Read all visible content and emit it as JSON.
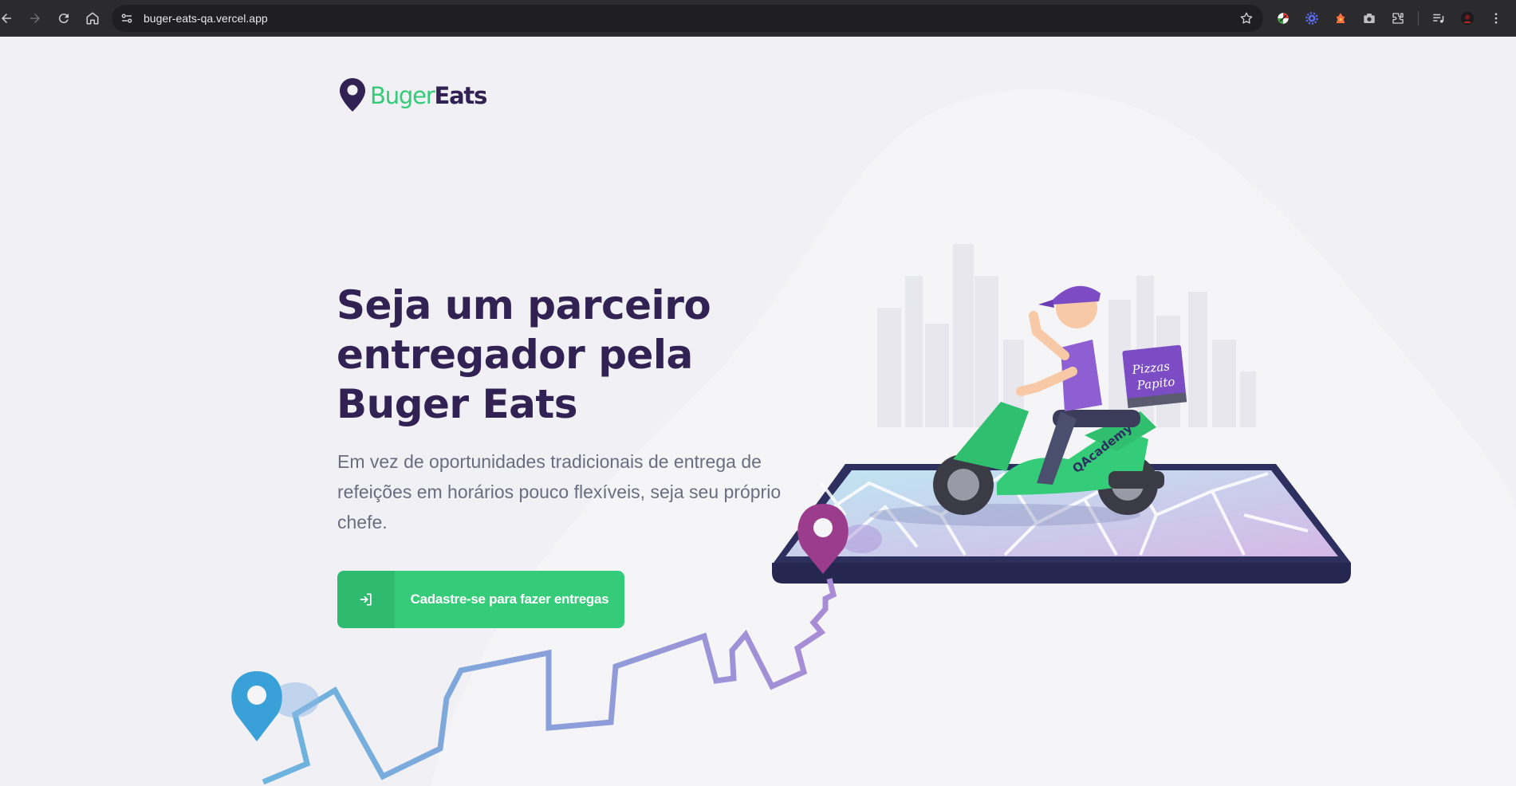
{
  "browser": {
    "url": "buger-eats-qa.vercel.app",
    "icons": [
      "back-icon",
      "forward-icon",
      "reload-icon",
      "home-icon",
      "site-info-icon",
      "bookmark-star-icon",
      "extensions-icon",
      "media-icon",
      "profile-avatar"
    ]
  },
  "header": {
    "brand_part1": "Buger",
    "brand_part2": "Eats"
  },
  "hero": {
    "title": "Seja um parceiro entregador pela Buger Eats",
    "subtitle": "Em vez de oportunidades tradicionais de entrega de refeições em horários pouco flexíveis, seja seu próprio chefe.",
    "cta_label": "Cadastre-se para fazer entregas",
    "box_text_line1": "Pizzas",
    "box_text_line2": "Papito",
    "scooter_text": "QAcademy"
  },
  "colors": {
    "primary": "#34cb79",
    "title": "#322153",
    "text": "#6c6c80",
    "background": "#f0f0f5",
    "accent_purple": "#9b3c8c",
    "pin_blue": "#3aa0d8"
  }
}
